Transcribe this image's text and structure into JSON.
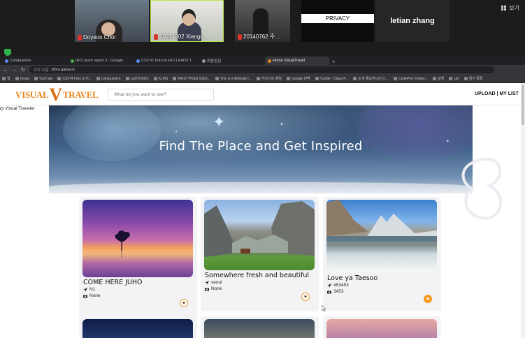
{
  "zoom": {
    "participants": [
      {
        "name": "Doyeon Choi",
        "muted": true
      },
      {
        "name": "20214902 Xiangc...",
        "muted": true
      },
      {
        "name": "20140762 주...",
        "muted": true
      },
      {
        "name": "",
        "overlay": "PRIVACY"
      },
      {
        "name": "letian zhang"
      }
    ],
    "view_label": "보기"
  },
  "browser": {
    "tabs": [
      {
        "label": "Campuswire",
        "active": false
      },
      {
        "label": "[HCI team report 3 - Google",
        "active": false
      },
      {
        "label": "CS374: Intro to HCI | KAIST L",
        "active": false
      },
      {
        "label": "최종점검",
        "active": false
      },
      {
        "label": "Home VisualTravel",
        "active": true
      }
    ],
    "new_tab": "+",
    "url_prefix": "주의 요함",
    "url": "ytbro.gabia.io",
    "bookmarks": [
      "앱",
      "Gmail",
      "YouTube",
      "CS374 Intro to H...",
      "Campuswire",
      "cs379-2021",
      "KLMS",
      "KAIST Portal SSO(...",
      "This is a Website f...",
      "카이스트 메일",
      "Google 번역",
      "Tumblr - Class P...",
      "소개 해요!하시인스...",
      "CodePen: Online...",
      "설명",
      "LEi",
      "읽기 목록"
    ]
  },
  "site": {
    "logo_left": "VISUAL",
    "logo_v": "V",
    "logo_right": "TRAVEL",
    "search_placeholder": "What do you want to see?",
    "nav_upload": "UPLOAD",
    "nav_sep": "|",
    "nav_mylist": "MY LIST",
    "side_label": "Visual Traveler",
    "hero_title": "Find The Place and Get Inspired",
    "cards": [
      {
        "title": "COME HERE JUHO",
        "location": "N1",
        "camera": "None",
        "liked": false
      },
      {
        "title": "Somewhere fresh and beautiful",
        "location": "seoul",
        "camera": "None",
        "liked": false
      },
      {
        "title": "Love ya Taesoo",
        "location": "453453",
        "camera": "3453",
        "liked": true
      }
    ],
    "heart_glyph": "♥",
    "colors": {
      "accent": "#f59b25",
      "logo": "#e8881d"
    }
  }
}
